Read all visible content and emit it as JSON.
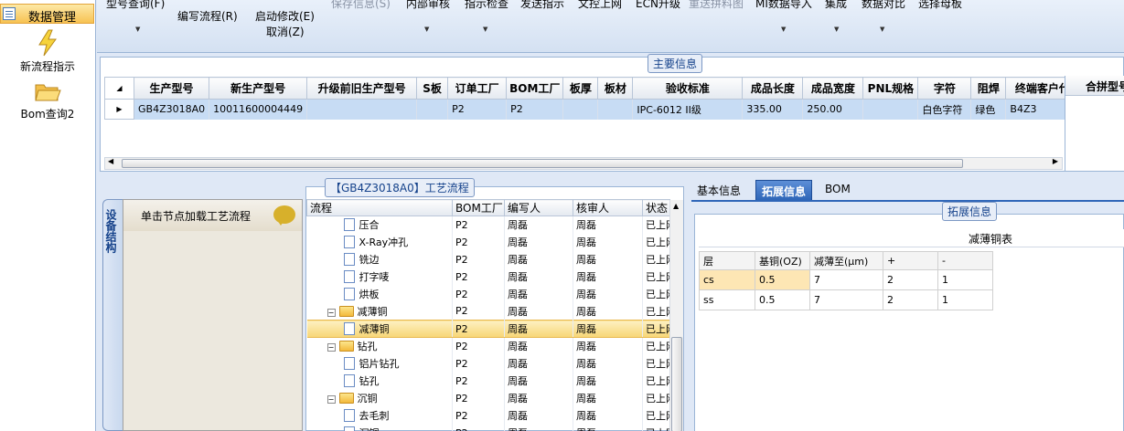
{
  "nav": {
    "header": "数据管理",
    "items": [
      {
        "label": "新流程指示",
        "icon": "lightning-icon"
      },
      {
        "label": "Bom查询2",
        "icon": "folder-open-icon"
      }
    ]
  },
  "toolbar": {
    "items": [
      {
        "label": "型号查询(F)",
        "disabled": false
      },
      {
        "label": "编写流程(R)",
        "disabled": false
      },
      {
        "label": "启动修改(E)",
        "disabled": false
      },
      {
        "label": "取消(Z)",
        "disabled": false
      },
      {
        "label": "保存信息(S)",
        "disabled": true
      },
      {
        "label": "内部审核",
        "disabled": false
      },
      {
        "label": "指示检查",
        "disabled": false
      },
      {
        "label": "发送指示",
        "disabled": false
      },
      {
        "label": "文控上网",
        "disabled": false
      },
      {
        "label": "ECN升级",
        "disabled": false
      },
      {
        "label": "重送拼料图",
        "disabled": true
      },
      {
        "label": "MI数据导入",
        "disabled": false
      },
      {
        "label": "集成",
        "disabled": false
      },
      {
        "label": "数据对比",
        "disabled": false
      },
      {
        "label": "选择母板",
        "disabled": false
      }
    ]
  },
  "main_info": {
    "title": "主要信息",
    "columns": [
      "生产型号",
      "新生产型号",
      "升级前旧生产型号",
      "S板",
      "订单工厂",
      "BOM工厂",
      "板厚",
      "板材",
      "验收标准",
      "成品长度",
      "成品宽度",
      "PNL规格",
      "字符",
      "阻焊",
      "终端客户代码"
    ],
    "rows": [
      [
        "GB4Z3018A0",
        "10011600004449",
        "",
        "",
        "P2",
        "P2",
        "",
        "",
        "IPC-6012 II级",
        "335.00",
        "250.00",
        "",
        "白色字符",
        "绿色",
        "B4Z3"
      ]
    ],
    "right_column": "合拼型号"
  },
  "left_panel": {
    "vtab": "设备结构",
    "header": "单击节点加载工艺流程"
  },
  "flow": {
    "title": "【GB4Z3018A0】工艺流程",
    "columns": [
      "流程",
      "BOM工厂",
      "编写人",
      "核审人",
      "状态"
    ],
    "rows": [
      {
        "name": "压合",
        "type": "file",
        "level": 2,
        "bom": "P2",
        "writer": "周磊",
        "reviewer": "周磊",
        "status": "已上网"
      },
      {
        "name": "X-Ray冲孔",
        "type": "file",
        "level": 2,
        "bom": "P2",
        "writer": "周磊",
        "reviewer": "周磊",
        "status": "已上网"
      },
      {
        "name": "铣边",
        "type": "file",
        "level": 2,
        "bom": "P2",
        "writer": "周磊",
        "reviewer": "周磊",
        "status": "已上网"
      },
      {
        "name": "打字唛",
        "type": "file",
        "level": 2,
        "bom": "P2",
        "writer": "周磊",
        "reviewer": "周磊",
        "status": "已上网"
      },
      {
        "name": "烘板",
        "type": "file",
        "level": 2,
        "bom": "P2",
        "writer": "周磊",
        "reviewer": "周磊",
        "status": "已上网"
      },
      {
        "name": "减薄铜",
        "type": "folder",
        "level": 1,
        "bom": "P2",
        "writer": "周磊",
        "reviewer": "周磊",
        "status": "已上网"
      },
      {
        "name": "减薄铜",
        "type": "file",
        "level": 2,
        "bom": "P2",
        "writer": "周磊",
        "reviewer": "周磊",
        "status": "已上网",
        "selected": true
      },
      {
        "name": "钻孔",
        "type": "folder",
        "level": 1,
        "bom": "P2",
        "writer": "周磊",
        "reviewer": "周磊",
        "status": "已上网"
      },
      {
        "name": "铝片钻孔",
        "type": "file",
        "level": 2,
        "bom": "P2",
        "writer": "周磊",
        "reviewer": "周磊",
        "status": "已上网"
      },
      {
        "name": "钻孔",
        "type": "file",
        "level": 2,
        "bom": "P2",
        "writer": "周磊",
        "reviewer": "周磊",
        "status": "已上网"
      },
      {
        "name": "沉铜",
        "type": "folder",
        "level": 1,
        "bom": "P2",
        "writer": "周磊",
        "reviewer": "周磊",
        "status": "已上网"
      },
      {
        "name": "去毛刺",
        "type": "file",
        "level": 2,
        "bom": "P2",
        "writer": "周磊",
        "reviewer": "周磊",
        "status": "已上网"
      },
      {
        "name": "沉铜",
        "type": "file",
        "level": 2,
        "bom": "P2",
        "writer": "周磊",
        "reviewer": "周磊",
        "status": "已上网"
      }
    ]
  },
  "right_tabs": {
    "tabs": [
      "基本信息",
      "拓展信息",
      "BOM"
    ],
    "active": 1,
    "section_title": "拓展信息",
    "table_title": "减薄铜表",
    "columns": [
      "层",
      "基铜(OZ)",
      "减薄至(μm)",
      "+",
      "-"
    ],
    "rows": [
      [
        "cs",
        "0.5",
        "7",
        "2",
        "1"
      ],
      [
        "ss",
        "0.5",
        "7",
        "2",
        "1"
      ]
    ]
  }
}
